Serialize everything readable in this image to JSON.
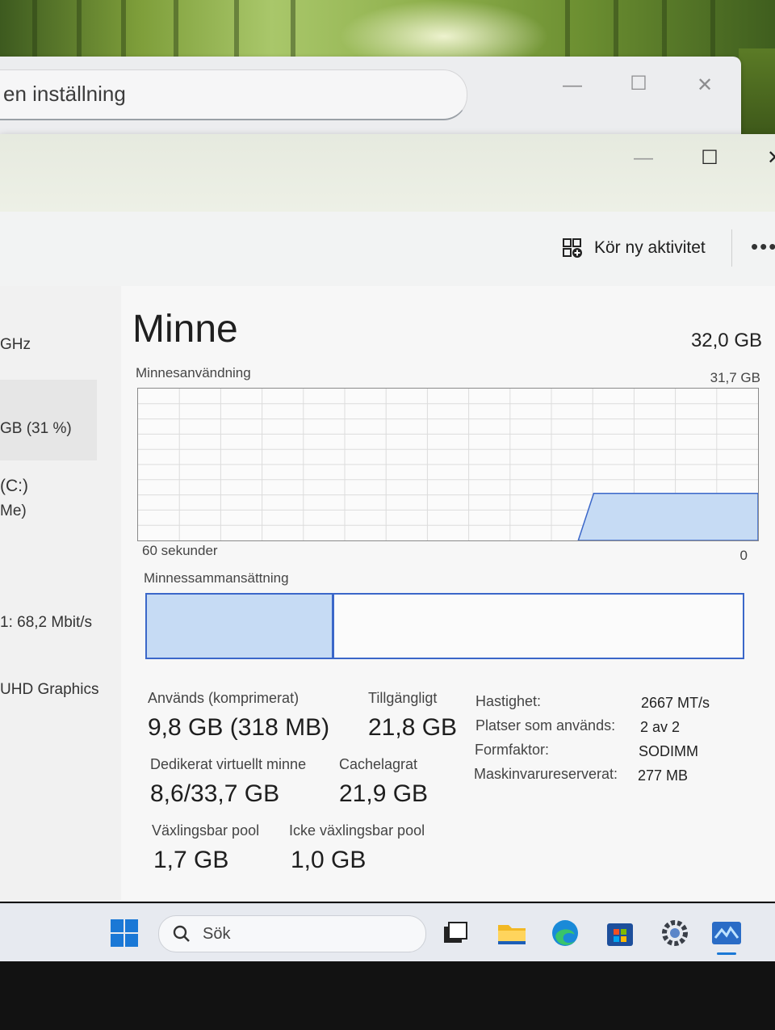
{
  "settings_window": {
    "search_text": "en inställning",
    "minimize_glyph": "—",
    "maximize_glyph": "☐",
    "close_glyph": "✕"
  },
  "task_manager": {
    "window_controls": {
      "minimize_glyph": "—",
      "maximize_glyph": "☐",
      "close_glyph": "✕"
    },
    "toolbar": {
      "run_task_label": "Kör ny aktivitet",
      "more_glyph": "•••"
    },
    "sidebar": {
      "items": [
        {
          "text": "GHz"
        },
        {
          "text": "GB (31 %)"
        },
        {
          "text": "(C:)"
        },
        {
          "text": "Me)"
        },
        {
          "text": "1: 68,2 Mbit/s"
        },
        {
          "text": "UHD Graphics"
        }
      ]
    },
    "memory": {
      "title": "Minne",
      "total": "32,0 GB",
      "usage_label": "Minnesanvändning",
      "graph_max_label": "31,7 GB",
      "graph_time_label": "60 sekunder",
      "graph_zero_label": "0",
      "composition_label": "Minnessammansättning",
      "composition_used_fraction": 0.31,
      "graph_usage_fraction": 0.31,
      "stats": {
        "in_use_label": "Används (komprimerat)",
        "in_use_value": "9,8 GB (318 MB)",
        "available_label": "Tillgängligt",
        "available_value": "21,8 GB",
        "committed_label": "Dedikerat virtuellt minne",
        "committed_value": "8,6/33,7 GB",
        "cached_label": "Cachelagrat",
        "cached_value": "21,9 GB",
        "paged_label": "Växlingsbar pool",
        "paged_value": "1,7 GB",
        "nonpaged_label": "Icke växlingsbar pool",
        "nonpaged_value": "1,0 GB"
      },
      "properties": [
        {
          "key": "Hastighet:",
          "value": "2667 MT/s"
        },
        {
          "key": "Platser som används:",
          "value": "2 av 2"
        },
        {
          "key": "Formfaktor:",
          "value": "SODIMM"
        },
        {
          "key": "Maskinvarureserverat:",
          "value": "277 MB"
        }
      ]
    }
  },
  "taskbar": {
    "search_placeholder": "Sök",
    "icons": [
      "start-icon",
      "task-view-icon",
      "file-explorer-icon",
      "edge-icon",
      "store-icon",
      "settings-icon",
      "task-manager-icon"
    ]
  },
  "colors": {
    "graph_fill": "#c6dbf4",
    "graph_line": "#3b67c9",
    "window_bg": "#f3f3f3"
  }
}
